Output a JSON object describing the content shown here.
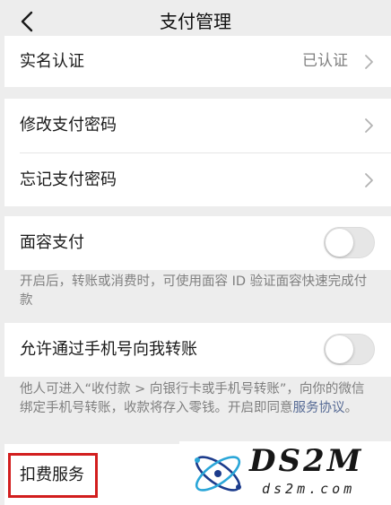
{
  "header": {
    "title": "支付管理",
    "back_icon": "chevron-left-icon"
  },
  "real_name": {
    "label": "实名认证",
    "value": "已认证"
  },
  "password": {
    "change_label": "修改支付密码",
    "forgot_label": "忘记支付密码"
  },
  "face_pay": {
    "label": "面容支付",
    "enabled": false,
    "tip": "开启后，转账或消费时，可使用面容 ID 验证面容快速完成付款"
  },
  "phone_transfer": {
    "label": "允许通过手机号向我转账",
    "enabled": false,
    "tip_prefix": "他人可进入“收付款 > 向银行卡或手机号转账”，向你的微信绑定手机号转账，收款将存入零钱。开启即同意",
    "tip_link": "服务协议",
    "tip_suffix": "。"
  },
  "deduct": {
    "label": "扣费服务"
  },
  "watermark": {
    "brand": "DS2M",
    "site": "ds2m.com"
  },
  "colors": {
    "background": "#ededed",
    "link": "#576b95",
    "highlight": "#d21e1e"
  }
}
